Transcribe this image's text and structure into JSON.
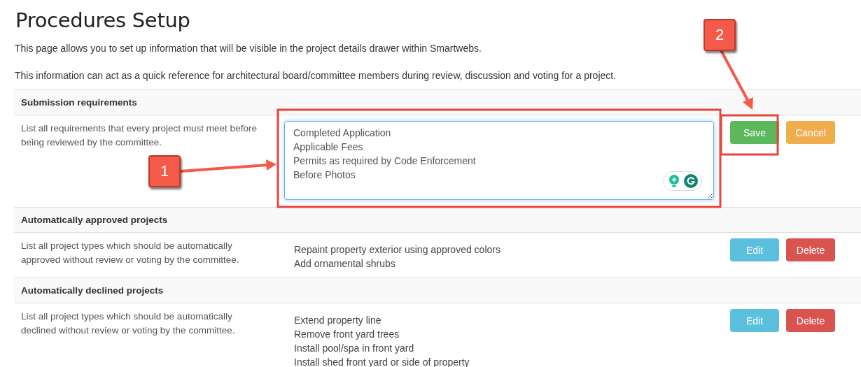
{
  "title": "Procedures Setup",
  "intro": [
    "This page allows you to set up information that will be visible in the project details drawer within Smartwebs.",
    "This information can act as a quick reference for architectural board/committee members during review, discussion and voting for a project."
  ],
  "sections": [
    {
      "kind": "editing",
      "heading": "Submission requirements",
      "description": "List all requirements that every project must meet before being reviewed by the committee.",
      "value": "Completed Application\nApplicable Fees\nPermits as required by Code Enforcement\nBefore Photos",
      "buttons": [
        {
          "label": "Save",
          "kind": "success"
        },
        {
          "label": "Cancel",
          "kind": "warning"
        }
      ]
    },
    {
      "kind": "view",
      "heading": "Automatically approved projects",
      "description": "List all project types which should be automatically approved without review or voting by the committee.",
      "items": [
        "Repaint property exterior using approved colors",
        "Add ornamental shrubs"
      ],
      "buttons": [
        {
          "label": "Edit",
          "kind": "info"
        },
        {
          "label": "Delete",
          "kind": "danger"
        }
      ]
    },
    {
      "kind": "view",
      "heading": "Automatically declined projects",
      "description": "List all project types which should be automatically declined without review or voting by the committee.",
      "items": [
        "Extend property line",
        "Remove front yard trees",
        "Install pool/spa in front yard",
        "Install shed front yard or side of property"
      ],
      "buttons": [
        {
          "label": "Edit",
          "kind": "info"
        },
        {
          "label": "Delete",
          "kind": "danger"
        }
      ]
    }
  ],
  "callouts": [
    {
      "label": "1"
    },
    {
      "label": "2"
    }
  ]
}
